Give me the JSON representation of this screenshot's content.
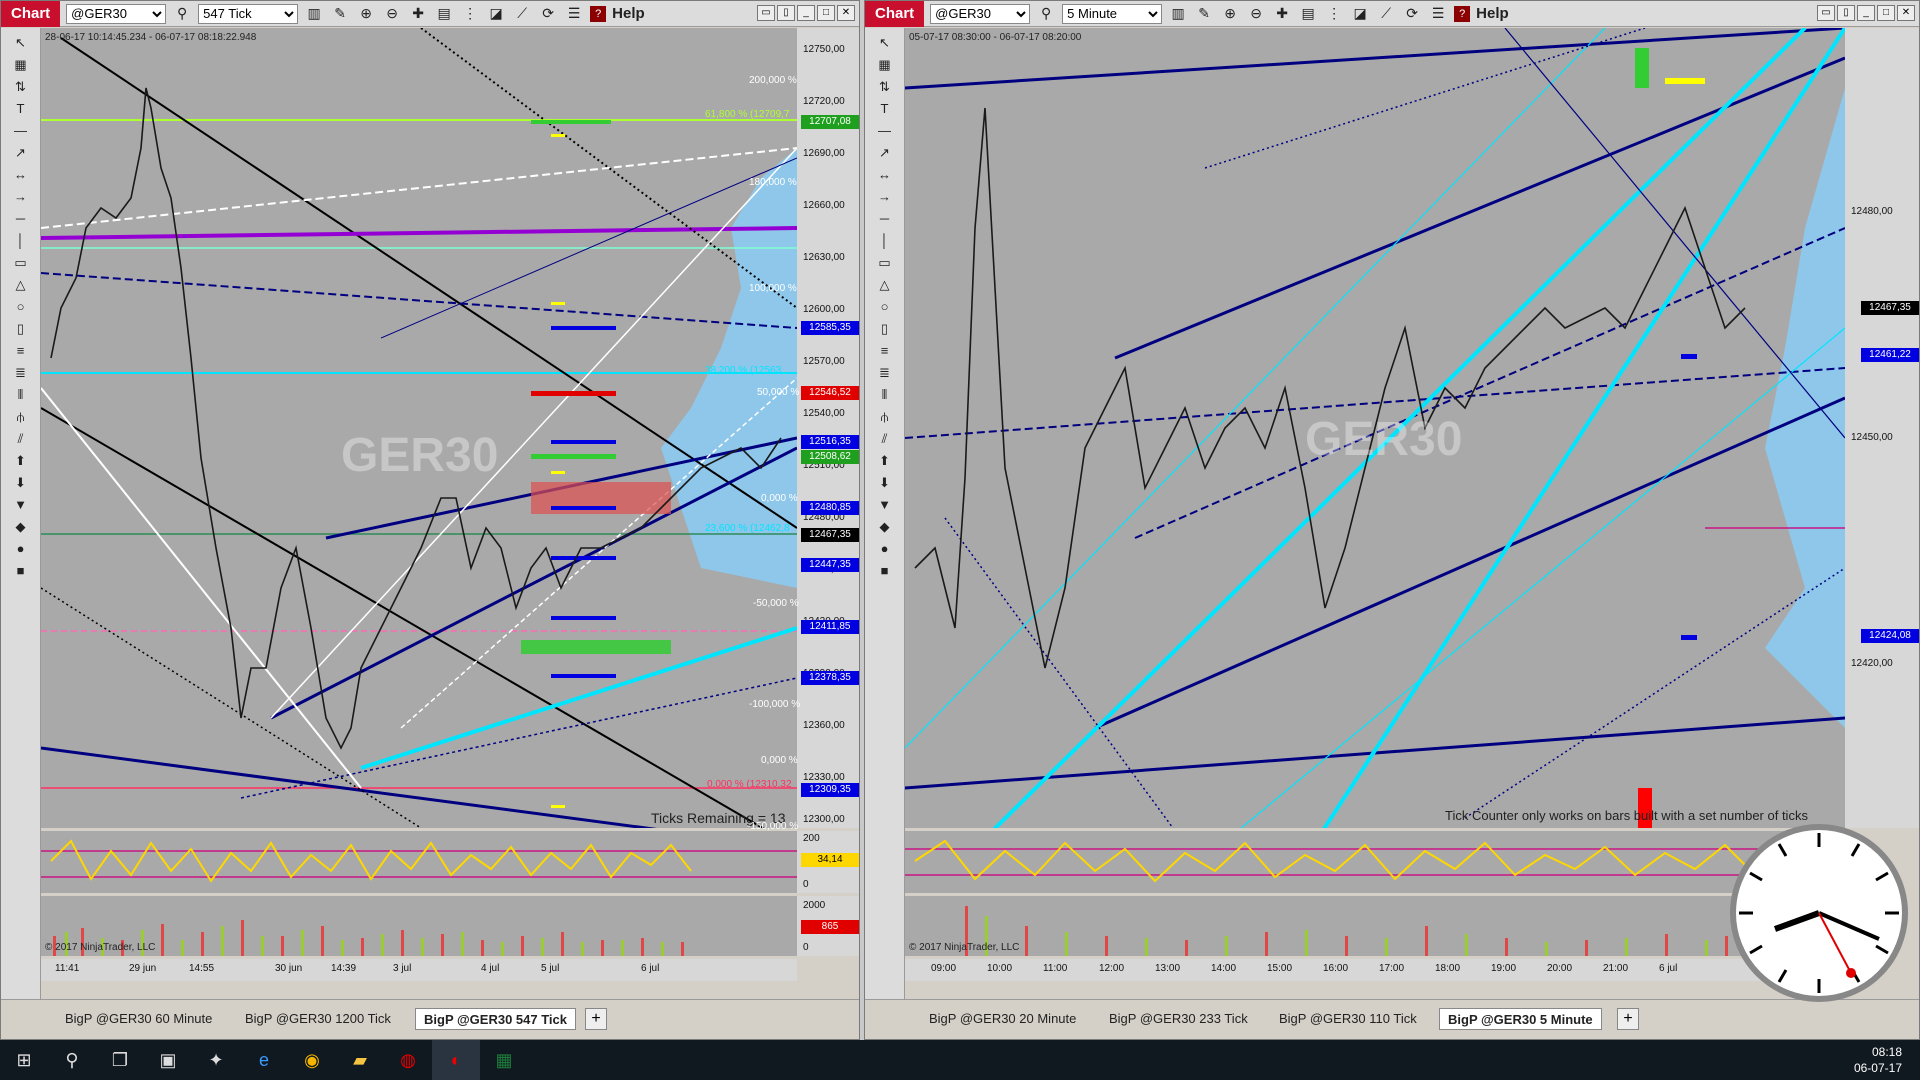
{
  "left": {
    "chart_button": "Chart",
    "instrument": "@GER30",
    "interval": "547 Tick",
    "help": "Help",
    "date_range": "28-06-17 10:14:45.234 - 06-07-17 08:18:22.948",
    "watermark": "GER30",
    "ticks_remaining": "Ticks Remaining = 13",
    "copyright": "© 2017 NinjaTrader, LLC",
    "price_ticks": [
      "12750,00",
      "12720,00",
      "12690,00",
      "12660,00",
      "12630,00",
      "12600,00",
      "12570,00",
      "12540,00",
      "12510,00",
      "12480,00",
      "12450,00",
      "12420,00",
      "12390,00",
      "12360,00",
      "12330,00",
      "12300,00"
    ],
    "price_tags": [
      {
        "v": "12707,08",
        "c": "#1ea01e"
      },
      {
        "v": "12585,35",
        "c": "#0000e0"
      },
      {
        "v": "12546,52",
        "c": "#e00000"
      },
      {
        "v": "12516,35",
        "c": "#0000e0"
      },
      {
        "v": "12508,62",
        "c": "#1ea01e"
      },
      {
        "v": "12480,85",
        "c": "#0000e0"
      },
      {
        "v": "12467,35",
        "c": "#000000"
      },
      {
        "v": "12447,35",
        "c": "#0000e0"
      },
      {
        "v": "12411,85",
        "c": "#0000e0"
      },
      {
        "v": "12378,35",
        "c": "#0000e0"
      },
      {
        "v": "12309,35",
        "c": "#0000e0"
      }
    ],
    "fib_labels": [
      "200,000 %",
      "61,800 % (12709,7",
      "180,000 %",
      "100,000 %",
      "38,200 % (12563",
      "50,000 %",
      "0,000 %",
      "23,600 % (12462,8",
      "-50,000 %",
      "-100,000 %",
      "0,000 %",
      "0,000 % (12310,32",
      "-150,000 %"
    ],
    "osc_ticks": [
      "200",
      "0"
    ],
    "osc_tag": "34,14",
    "vol_ticks": [
      "2000",
      "0"
    ],
    "vol_tag": "865",
    "x_labels": [
      "11:41",
      "29 jun",
      "14:55",
      "30 jun",
      "14:39",
      "3 jul",
      "4 jul",
      "5 jul",
      "6 jul"
    ],
    "tabs": [
      "BigP @GER30 60 Minute",
      "BigP @GER30 1200 Tick",
      "BigP @GER30 547 Tick"
    ]
  },
  "right": {
    "chart_button": "Chart",
    "instrument": "@GER30",
    "interval": "5 Minute",
    "help": "Help",
    "date_range": "05-07-17 08:30:00 - 06-07-17 08:20:00",
    "watermark": "GER30",
    "tick_note": "Tick Counter only works on bars built with a set number of ticks",
    "copyright": "© 2017 NinjaTrader, LLC",
    "price_ticks": [
      "12480,00",
      "12450,00",
      "12420,00"
    ],
    "price_tags": [
      {
        "v": "12467,35",
        "c": "#000000"
      },
      {
        "v": "12461,22",
        "c": "#0000e0"
      },
      {
        "v": "12424,08",
        "c": "#0000e0"
      }
    ],
    "x_labels": [
      "09:00",
      "10:00",
      "11:00",
      "12:00",
      "13:00",
      "14:00",
      "15:00",
      "16:00",
      "17:00",
      "18:00",
      "19:00",
      "20:00",
      "21:00",
      "6 jul"
    ],
    "tabs": [
      "BigP @GER30 20 Minute",
      "BigP @GER30 233 Tick",
      "BigP @GER30 110 Tick",
      "BigP @GER30 5 Minute"
    ]
  },
  "taskbar": {
    "time": "08:18",
    "date": "06-07-17"
  }
}
